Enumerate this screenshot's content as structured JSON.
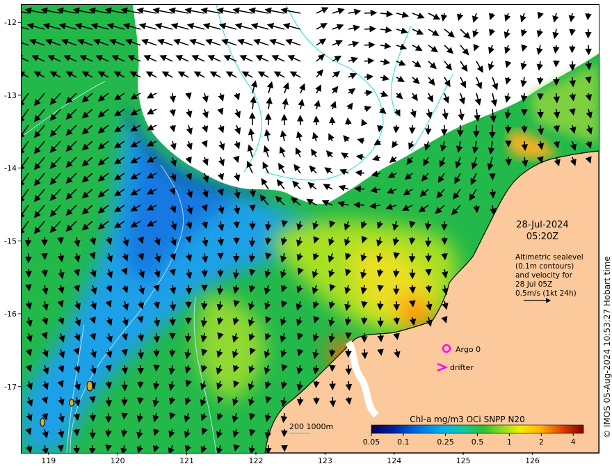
{
  "map": {
    "lat_ticks": [
      "-12",
      "-13",
      "-14",
      "-15",
      "-16",
      "-17"
    ],
    "lon_ticks": [
      "119",
      "120",
      "121",
      "122",
      "123",
      "124",
      "125",
      "126"
    ],
    "lon_range": [
      118.6,
      126.95
    ],
    "lat_range": [
      -17.9,
      -11.75
    ]
  },
  "annotation": {
    "date": "28-Jul-2024",
    "time": "05:20Z",
    "description_lines": [
      "Altimetric sealevel",
      "(0.1m contours)",
      "and velocity for",
      "28 Jul 05Z",
      "0.5m/s (1kt 24h)"
    ]
  },
  "markers": {
    "argo_label": "Argo 0",
    "drifter_label": "drifter",
    "argo_color": "#ff00ff",
    "drifter_color": "#ff00ff"
  },
  "bathymetry": {
    "label": "200  1000m",
    "line_color": "#44e0e0"
  },
  "colorbar": {
    "title": "Chl-a mg/m3 OCi SNPP N20",
    "ticks": [
      "0.05",
      "0.1",
      "0.25",
      "0.5",
      "1",
      "2",
      "4"
    ],
    "scale": "log"
  },
  "colors": {
    "land": "#fbc99b",
    "cloud": "#ffffff",
    "coastline": "#000000",
    "contour": "#44e0e0"
  },
  "credit": "© IMOS 05-Aug-2024 10:53:27 Hobart time"
}
